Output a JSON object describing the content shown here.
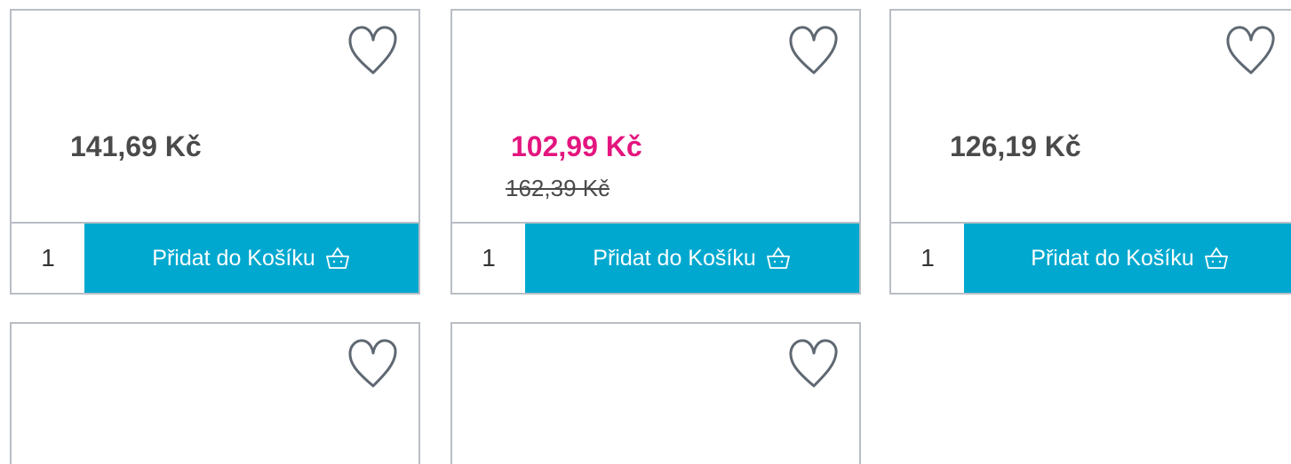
{
  "cards": [
    {
      "price": "141,69 Kč",
      "old_price": "",
      "qty": "1",
      "add_label": "Přidat do Košíku"
    },
    {
      "price": "102,99 Kč",
      "old_price": "162,39 Kč",
      "qty": "1",
      "add_label": "Přidat do Košíku"
    },
    {
      "price": "126,19 Kč",
      "old_price": "",
      "qty": "1",
      "add_label": "Přidat do Košíku"
    },
    {
      "price": "",
      "old_price": "",
      "qty": "",
      "add_label": ""
    },
    {
      "price": "",
      "old_price": "",
      "qty": "",
      "add_label": ""
    }
  ],
  "colors": {
    "accent": "#00a8cf",
    "sale": "#e4157f",
    "border": "#b9bec5",
    "icon": "#5f6872"
  },
  "icons": {
    "wishlist": "heart-outline-icon",
    "cart": "basket-icon"
  }
}
